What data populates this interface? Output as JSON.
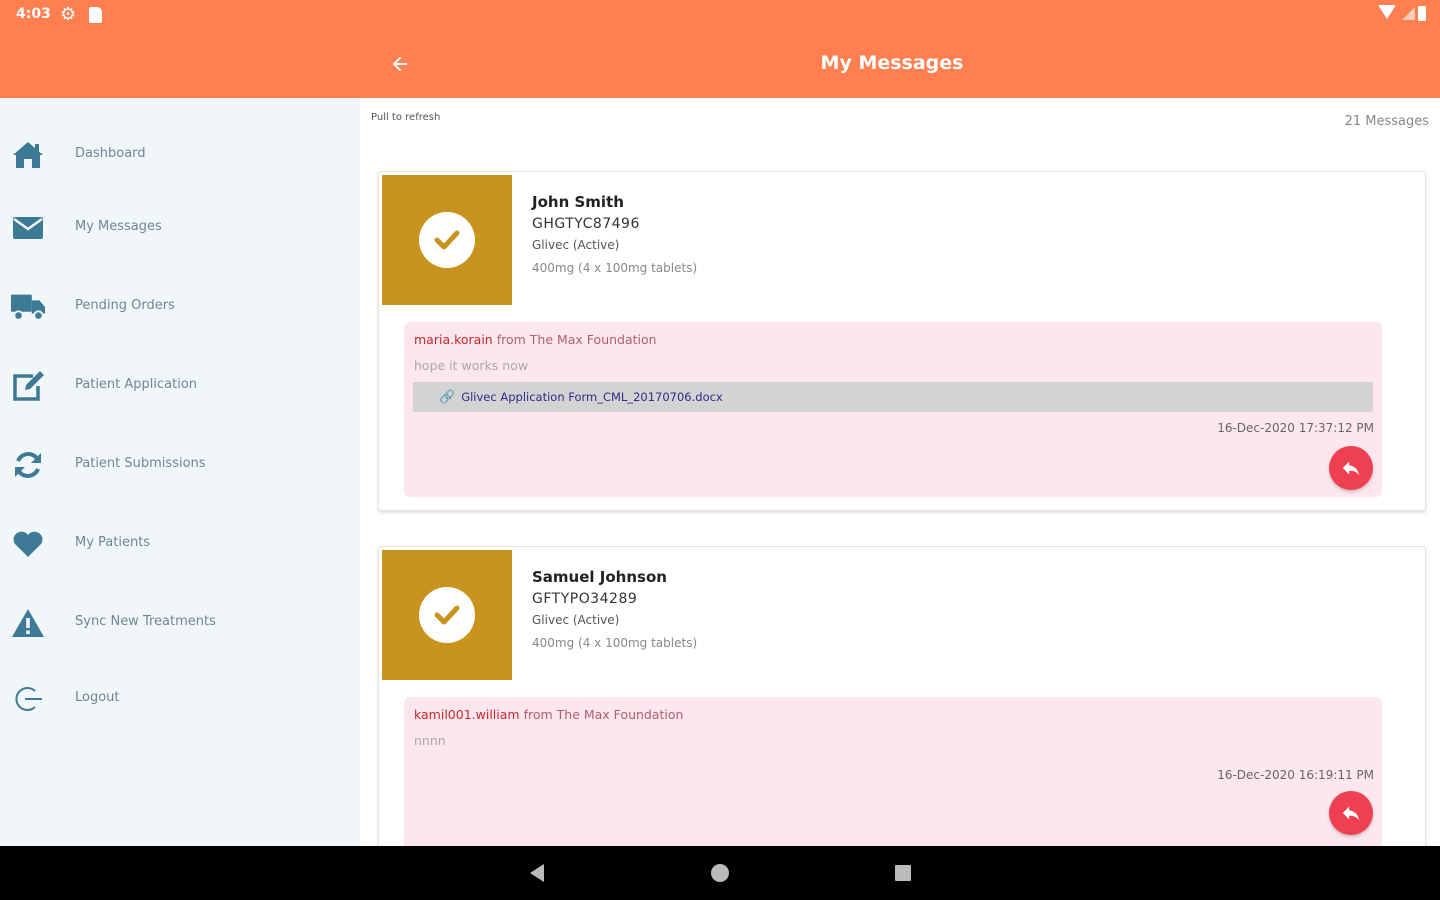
{
  "status_bar": {
    "time": "4:03"
  },
  "header": {
    "title": "My Messages"
  },
  "sidebar": {
    "items": [
      {
        "label": "Dashboard",
        "icon": "home-icon"
      },
      {
        "label": "My Messages",
        "icon": "envelope-icon"
      },
      {
        "label": "Pending Orders",
        "icon": "truck-icon"
      },
      {
        "label": "Patient Application",
        "icon": "edit-icon"
      },
      {
        "label": "Patient Submissions",
        "icon": "sync-icon"
      },
      {
        "label": "My Patients",
        "icon": "heart-icon"
      },
      {
        "label": "Sync New Treatments",
        "icon": "warning-icon"
      },
      {
        "label": "Logout",
        "icon": "logout-icon"
      }
    ]
  },
  "main": {
    "pull_to_refresh": "Pull to refresh",
    "message_count": "21 Messages",
    "cards": [
      {
        "patient_name": "John Smith",
        "patient_id": "GHGTYC87496",
        "drug": "Glivec (Active)",
        "dose": "400mg (4 x 100mg tablets)",
        "message": {
          "sender": "maria.korain",
          "from": "from The Max Foundation",
          "body": "hope it works now",
          "attachment": "Glivec Application Form_CML_20170706.docx",
          "timestamp": "16-Dec-2020 17:37:12 PM"
        }
      },
      {
        "patient_name": "Samuel Johnson",
        "patient_id": "GFTYPO34289",
        "drug": "Glivec (Active)",
        "dose": "400mg (4 x 100mg tablets)",
        "message": {
          "sender": "kamil001.william",
          "from": "from The Max Foundation",
          "body": "nnnn",
          "timestamp": "16-Dec-2020 16:19:11 PM"
        }
      }
    ]
  },
  "colors": {
    "app_bar": "#ff7f50",
    "sidebar_bg": "#f1f6f9",
    "sidebar_icon": "#3d7a96",
    "thumb_bg": "#c8941f",
    "message_bg": "#fde7ef",
    "reply_button": "#ee4050"
  }
}
